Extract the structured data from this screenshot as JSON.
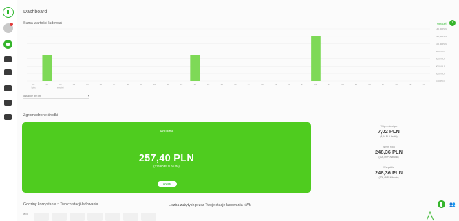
{
  "page": {
    "title": "Dashboard"
  },
  "sidebar": {
    "items": [
      {
        "icon": "leaf-logo-icon"
      },
      {
        "icon": "user-avatar-icon"
      },
      {
        "icon": "dashboard-icon",
        "active": true
      },
      {
        "icon": "charger-icon"
      },
      {
        "icon": "calendar-icon"
      },
      {
        "icon": "card-icon"
      },
      {
        "icon": "file-icon"
      },
      {
        "icon": "document-icon"
      }
    ]
  },
  "revenue_chart": {
    "title": "Suma wartości ładowań",
    "more_label": "Więcej",
    "period": "ostatnie 30 dni",
    "chart_data": {
      "type": "bar",
      "title": "Suma wartości ładowań",
      "x": [
        "01",
        "02",
        "03",
        "04",
        "05",
        "06",
        "07",
        "08",
        "09",
        "10",
        "11",
        "12",
        "13",
        "14",
        "15",
        "16",
        "17",
        "18",
        "19",
        "20",
        "21",
        "22",
        "23",
        "24",
        "25",
        "26",
        "27",
        "28",
        "29",
        "30"
      ],
      "values": [
        0,
        70,
        0,
        0,
        0,
        0,
        0,
        0,
        0,
        0,
        0,
        0,
        70,
        0,
        0,
        0,
        0,
        0,
        0,
        0,
        0,
        120,
        0,
        0,
        0,
        0,
        0,
        0,
        0,
        0
      ],
      "y_ticks": [
        "0,00 PLN",
        "20,00 PLN",
        "40,00 PLN",
        "60,00 PLN",
        "80,00 PLN",
        "100,00 PLN",
        "120,00 PLN",
        "140,00 PLN"
      ],
      "ylim": [
        0,
        140
      ],
      "x_sub_labels": {
        "01": "lipiec",
        "03": "sierpień"
      },
      "grid": true,
      "bar_color": "#7ed957"
    }
  },
  "funds": {
    "title": "Zgromadzone środki",
    "current_label": "Aktualnie",
    "amount": "257,40 PLN",
    "gross": "(316,60 PLN brutto)",
    "button": "Wypłać",
    "card_color": "#4fcc1f",
    "stats": [
      {
        "label": "W tym miesiącu",
        "value": "7,02 PLN",
        "sub": "(8,64 PLN brutto)"
      },
      {
        "label": "W tym roku",
        "value": "248,36 PLN",
        "sub": "(305,49 PLN brutto)"
      },
      {
        "label": "Wszystkie",
        "value": "248,36 PLN",
        "sub": "(305,49 PLN brutto)"
      }
    ]
  },
  "bottom": {
    "hours_title": "Godziny korzystania z Twoich stacji ładowania",
    "count_title": "Liczba zużytych przez Twoje stacje ładowania kWh",
    "mini_label": "08:00"
  }
}
